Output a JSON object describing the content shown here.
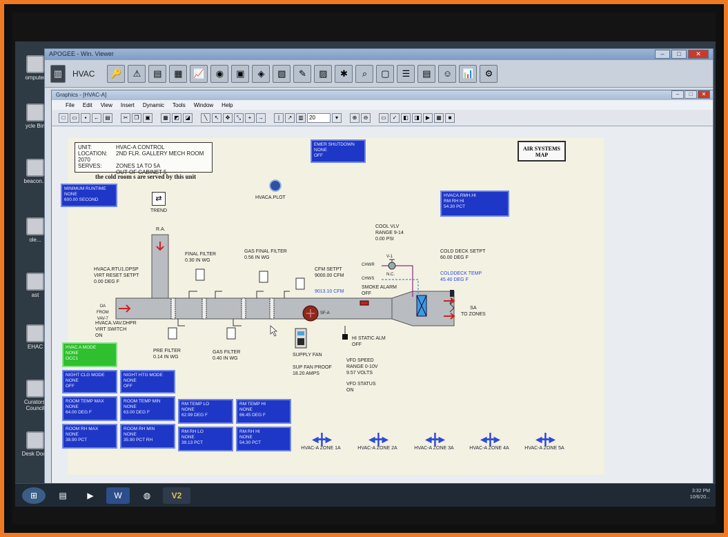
{
  "desktop": {
    "icons": [
      {
        "label": "omputer",
        "name": "computer"
      },
      {
        "label": "ycle Bin",
        "name": "recycle-bin"
      },
      {
        "label": "beacon...",
        "name": "beacon"
      },
      {
        "label": "ole...",
        "name": "folder-1"
      },
      {
        "label": "ast",
        "name": "folder-2"
      },
      {
        "label": "EHAC",
        "name": "ehac"
      },
      {
        "label": "Curators' Council",
        "name": "curators-council"
      },
      {
        "label": "Desk Docs",
        "name": "desk-docs"
      }
    ]
  },
  "app": {
    "title": "APOGEE - Win. Viewer",
    "toolbar_label": "HVAC"
  },
  "graphics": {
    "title": "Graphics - [HVAC-A]",
    "menu": [
      "File",
      "Edit",
      "View",
      "Insert",
      "Dynamic",
      "Tools",
      "Window",
      "Help"
    ],
    "zoom": "20"
  },
  "canvas": {
    "unit_info": {
      "unit_label": "UNIT:",
      "unit_value": "HVAC-A CONTROL",
      "location_label": "LOCATION:",
      "location_value": "2ND FLR. GALLERY MECH ROOM 2070",
      "serves_label": "SERVES:",
      "serves_value": "ZONES 1A TO 5A",
      "cabinet": "OUT OF CABINET 5"
    },
    "note": "the cold room s are served by this unit",
    "emer_shutdown": {
      "l1": "EMER SHUTDOWN",
      "l2": "NONE",
      "l3": "OFF"
    },
    "air_systems_btn": {
      "l1": "AIR SYSTEMS",
      "l2": "MAP"
    },
    "min_runtime": {
      "l1": "MINIMUM RUNTIME",
      "l2": "NONE",
      "l3": "600.00 SECOND"
    },
    "trend_label": "TREND",
    "plot_label": "HVACA.PLOT",
    "rm_hi": {
      "l1": "HVACA.RMH.HI",
      "l2": "RM RH HI",
      "l3": "54.30 PCT"
    },
    "ra_label": "R.A.",
    "final_filter": {
      "l1": "FINAL FILTER",
      "l2": "0.30 IN WG"
    },
    "gas_final_filter": {
      "l1": "GAS FINAL FILTER",
      "l2": "0.56 IN WG"
    },
    "cool_vlv": {
      "l1": "COOL VLV",
      "l2": "RANGE 9-14",
      "l3": "0.00 PSI"
    },
    "v1_label": "V-1",
    "nc_label": "N.C.",
    "chwr_label": "CHWR",
    "chws_label": "CHWS",
    "cold_deck_setpt": {
      "l1": "COLD DECK SETPT",
      "l2": "60.00 DEG F"
    },
    "colddeck_temp": {
      "l1": "COLDDECK TEMP",
      "l2": "45.40 DEG F"
    },
    "rtu_dpsp": {
      "l1": "HVACA.RTU1.DPSP",
      "l2": "VIRT RESET SETPT",
      "l3": "0.00 DEG F"
    },
    "cfm_setpt": {
      "l1": "CFM SETPT",
      "l2": "9000.00 CFM"
    },
    "cfm_value": "9013.10 CFM",
    "smoke_alarm": {
      "l1": "SMOKE ALARM",
      "l2": "OFF"
    },
    "oa_label": {
      "l1": "OA",
      "l2": "FROM",
      "l3": "VAV-7"
    },
    "vav_dhpr": {
      "l1": "HVACA.VAV.DHPR",
      "l2": "VIRT SWITCH",
      "l3": "ON"
    },
    "sfa_label": "SF-A",
    "sa_label": {
      "l1": "SA",
      "l2": "TO ZONES"
    },
    "pre_filter": {
      "l1": "PRE FILTER",
      "l2": "0.14 IN WG"
    },
    "gas_filter": {
      "l1": "GAS FILTER",
      "l2": "0.40 IN WG"
    },
    "supply_fan": "SUPPLY FAN",
    "sup_fan_proof": {
      "l1": "SUP FAN PROOF",
      "l2": "18.20 AMPS"
    },
    "hi_static": {
      "l1": "HI STATIC ALM",
      "l2": "OFF"
    },
    "vfd_speed": {
      "l1": "VFD SPEED",
      "l2": "RANGE 0-10V",
      "l3": "9.57 VOLTS"
    },
    "vfd_status": {
      "l1": "VFD STATUS",
      "l2": "ON"
    },
    "hvac_mode": {
      "l1": "HVAC A MODE",
      "l2": "NONE",
      "l3": "OCC1"
    },
    "night_clg": {
      "l1": "NIGHT CLG MODE",
      "l2": "NONE",
      "l3": "OFF"
    },
    "night_htg": {
      "l1": "NIGHT HTG MODE",
      "l2": "NONE",
      "l3": "OFF"
    },
    "room_temp_max": {
      "l1": "ROOM TEMP MAX",
      "l2": "NONE",
      "l3": "64.00 DEG F"
    },
    "room_temp_min": {
      "l1": "ROOM TEMP MIN",
      "l2": "NONE",
      "l3": "63.00 DEG F"
    },
    "rm_temp_lo": {
      "l1": "RM TEMP LO",
      "l2": "NONE",
      "l3": "62.99 DEG F"
    },
    "rm_temp_hi": {
      "l1": "RM TEMP HI",
      "l2": "NONE",
      "l3": "66.45 DEG F"
    },
    "room_rh_max": {
      "l1": "ROOM RH MAX",
      "l2": "NONE",
      "l3": "38.90 PCT"
    },
    "room_rh_min": {
      "l1": "ROOM RH MIN",
      "l2": "NONE",
      "l3": "35.90 PCT RH"
    },
    "rm_rh_lo": {
      "l1": "RM RH LO",
      "l2": "NONE",
      "l3": "39.13 PCT"
    },
    "rm_rh_hi": {
      "l1": "RM RH HI",
      "l2": "NONE",
      "l3": "54.30 PCT"
    },
    "zones": [
      "HVAC-A ZONE 1A",
      "HVAC-A ZONE 2A",
      "HVAC-A ZONE 3A",
      "HVAC-A ZONE 4A",
      "HVAC-A ZONE 5A"
    ]
  },
  "taskbar": {
    "v2_label": "V2",
    "clock": "3:32 PM",
    "date": "10/6/20..."
  },
  "colors": {
    "frame": "#f07a24",
    "status_blue": "#1f37c7",
    "status_green": "#2fbf2f",
    "canvas_bg": "#f3f1e2",
    "duct_gray": "#b9bcc0"
  }
}
